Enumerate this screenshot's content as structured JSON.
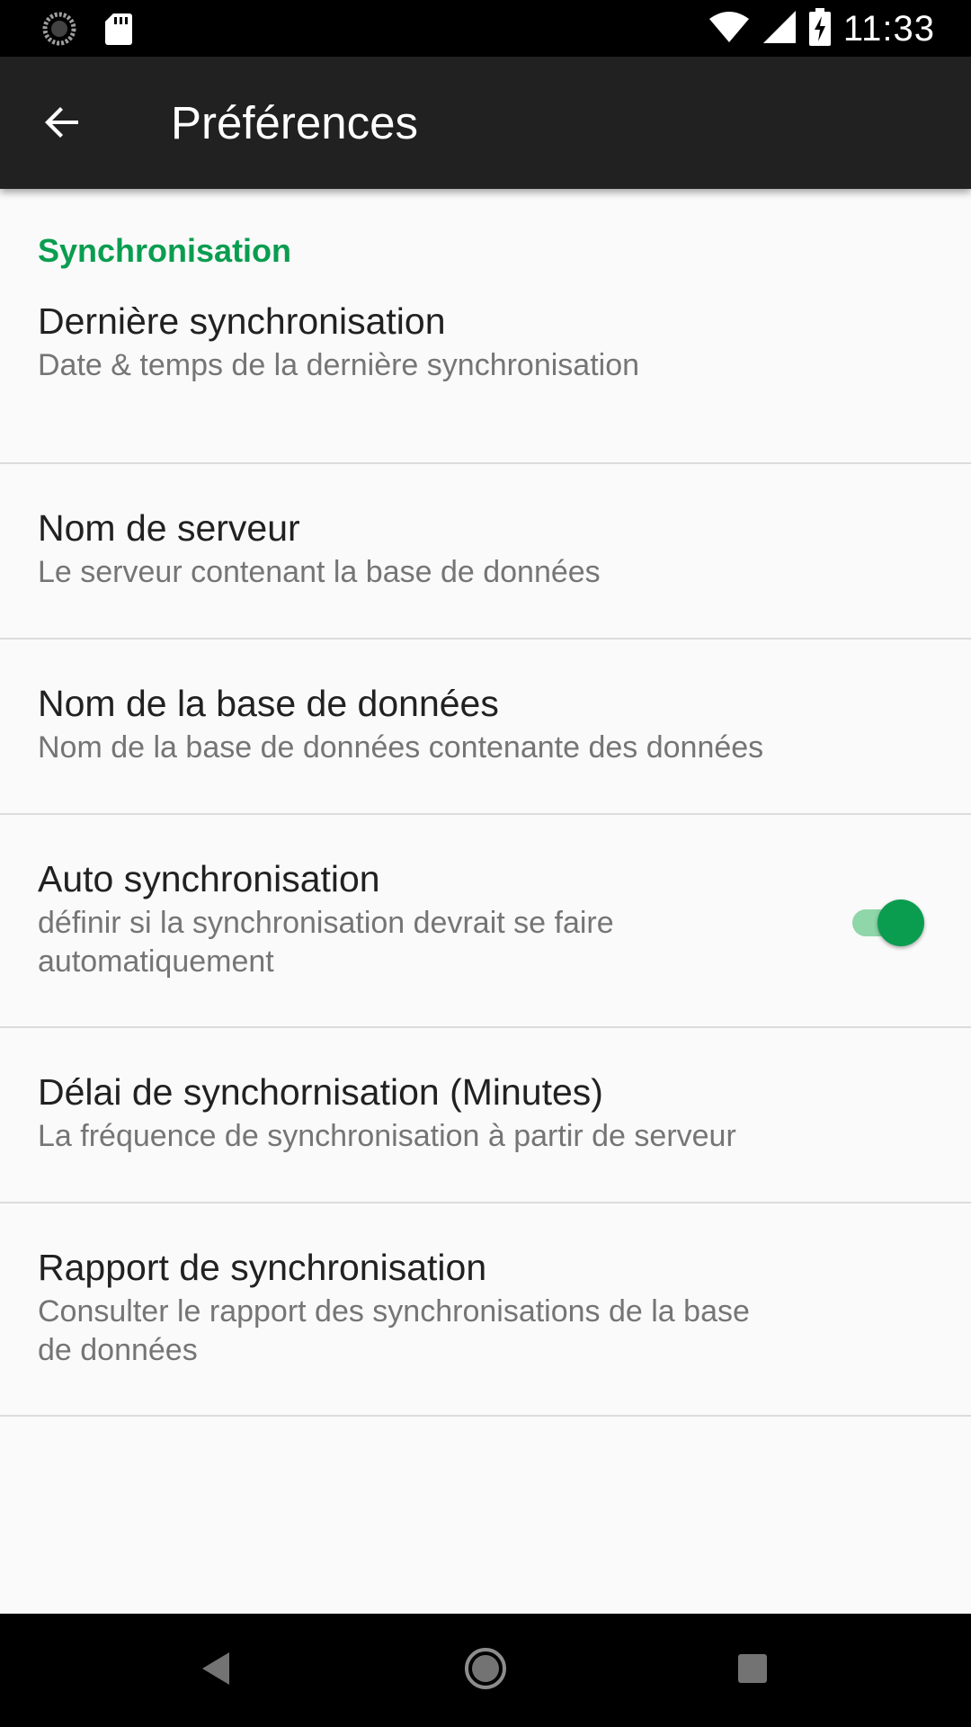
{
  "status_bar": {
    "time": "11:33",
    "icons": [
      "loading-circle-icon",
      "sd-card-icon",
      "wifi-icon",
      "signal-icon",
      "battery-charging-icon"
    ]
  },
  "app_bar": {
    "title": "Préférences",
    "back_icon": "arrow-back-icon"
  },
  "category": {
    "title": "Synchronisation",
    "accent_color": "#0a9d50"
  },
  "preferences": [
    {
      "title": "Dernière synchronisation",
      "summary": "Date & temps de la dernière synchronisation"
    },
    {
      "title": "Nom de serveur",
      "summary": "Le serveur contenant la base de données"
    },
    {
      "title": "Nom de la base de données",
      "summary": "Nom de la base de données contenante des données"
    },
    {
      "title": "Auto synchronisation",
      "summary": "définir si la synchronisation devrait se faire automatiquement",
      "switch_on": true
    },
    {
      "title": "Délai de synchornisation (Minutes)",
      "summary": "La fréquence de synchronisation à partir de serveur"
    },
    {
      "title": "Rapport de synchronisation",
      "summary": "Consulter le rapport des synchronisations de la base de données"
    }
  ],
  "nav_bar": {
    "icons": [
      "nav-back-icon",
      "nav-home-icon",
      "nav-recents-icon"
    ]
  }
}
